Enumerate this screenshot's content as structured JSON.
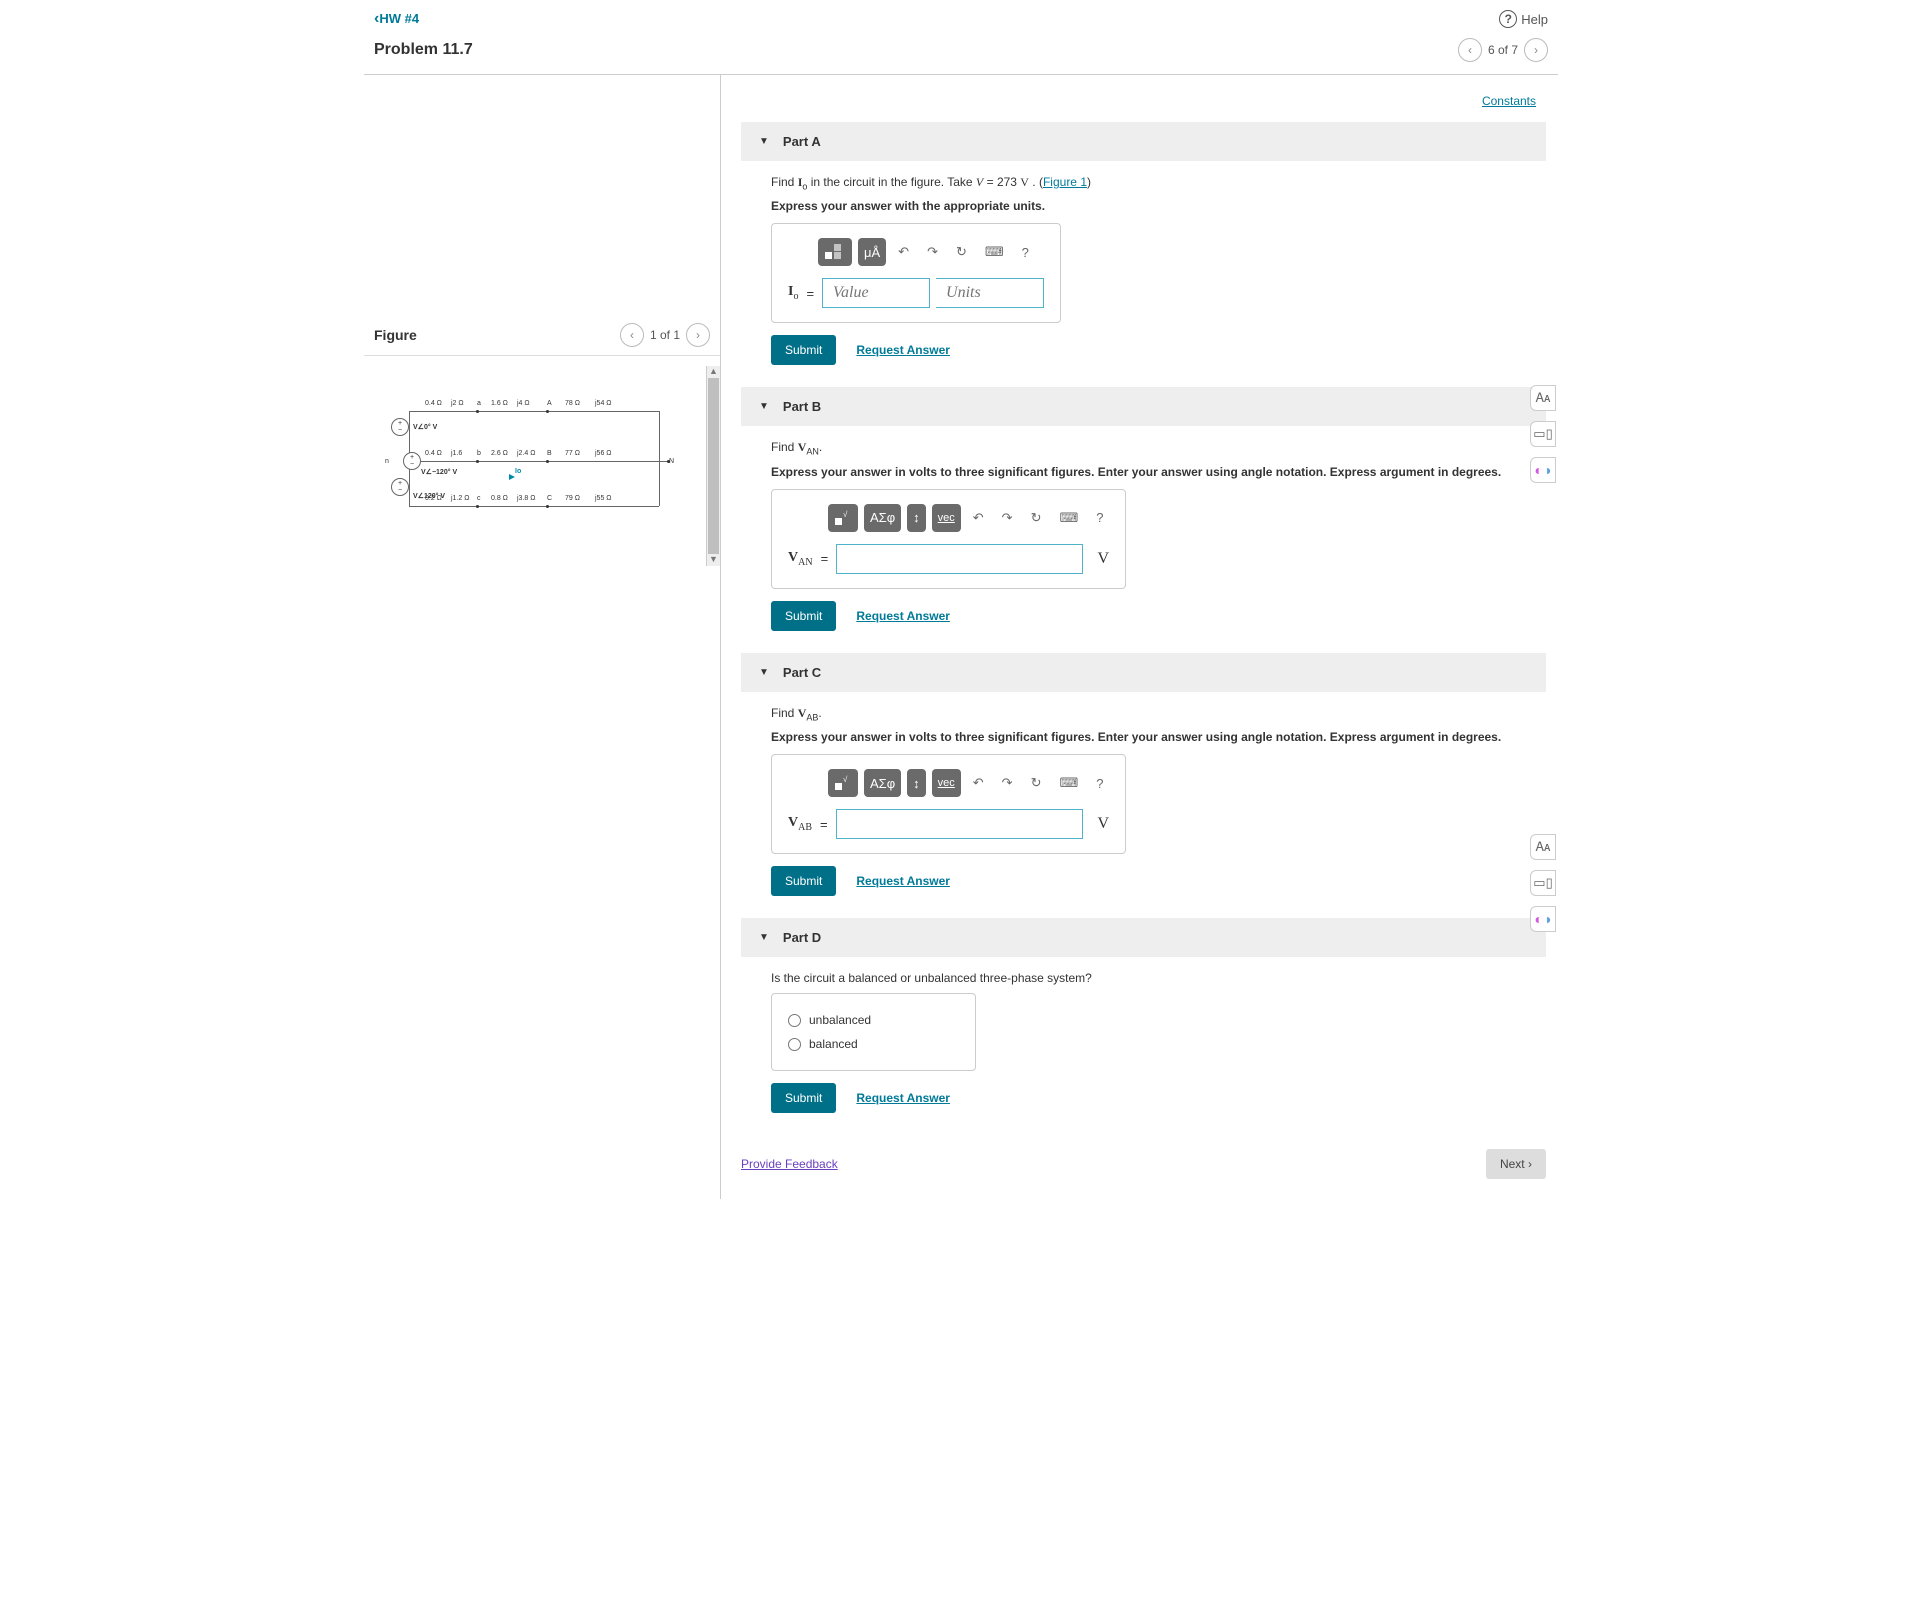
{
  "header": {
    "back_label": "HW #4",
    "help_label": "Help",
    "problem_title": "Problem 11.7",
    "page_indicator": "6 of 7"
  },
  "figure": {
    "title": "Figure",
    "page_indicator": "1 of 1",
    "labels": {
      "n": "n",
      "N": "N",
      "row_a": [
        "0.4 Ω",
        "j2 Ω",
        "a",
        "1.6 Ω",
        "j4 Ω",
        "A",
        "78 Ω",
        "j54 Ω"
      ],
      "row_b": [
        "0.4 Ω",
        "j1.6",
        "b",
        "2.6 Ω",
        "j2.4 Ω",
        "B",
        "77 Ω",
        "j56 Ω"
      ],
      "row_c": [
        "0.2 Ω",
        "j1.2 Ω",
        "c",
        "0.8 Ω",
        "j3.8 Ω",
        "C",
        "79 Ω",
        "j55 Ω"
      ],
      "src1": "V∠0° V",
      "src2": "V∠−120° V",
      "src3": "V∠120° V",
      "Io": "Io"
    }
  },
  "constants_label": "Constants",
  "parts": {
    "a": {
      "title": "Part A",
      "question_prefix": "Find ",
      "question_var": "I",
      "question_sub": "o",
      "question_mid": " in the circuit in the figure. Take ",
      "question_V": "V",
      "question_eq": " = 273 ",
      "question_unit": "V",
      "question_suffix": " . (",
      "figure_link": "Figure 1",
      "question_close": ")",
      "instruction": "Express your answer with the appropriate units.",
      "var_label": "I",
      "var_sub": "o",
      "value_placeholder": "Value",
      "units_placeholder": "Units",
      "submit": "Submit",
      "request": "Request Answer",
      "tb_mu": "μÅ"
    },
    "b": {
      "title": "Part B",
      "question_prefix": "Find ",
      "question_var": "V",
      "question_sub": "AN",
      "question_suffix": ".",
      "instruction": "Express your answer in volts to three significant figures. Enter your answer using angle notation. Express argument in degrees.",
      "var_label": "V",
      "var_sub": "AN",
      "unit_suffix": "V",
      "submit": "Submit",
      "request": "Request Answer",
      "tb_sigma": "ΑΣφ",
      "tb_vec": "vec"
    },
    "c": {
      "title": "Part C",
      "question_prefix": "Find ",
      "question_var": "V",
      "question_sub": "AB",
      "question_suffix": ".",
      "instruction": "Express your answer in volts to three significant figures. Enter your answer using angle notation. Express argument in degrees.",
      "var_label": "V",
      "var_sub": "AB",
      "unit_suffix": "V",
      "submit": "Submit",
      "request": "Request Answer",
      "tb_sigma": "ΑΣφ",
      "tb_vec": "vec"
    },
    "d": {
      "title": "Part D",
      "question": "Is the circuit a balanced or unbalanced three-phase system?",
      "option1": "unbalanced",
      "option2": "balanced",
      "submit": "Submit",
      "request": "Request Answer"
    }
  },
  "footer": {
    "feedback": "Provide Feedback",
    "next": "Next"
  }
}
